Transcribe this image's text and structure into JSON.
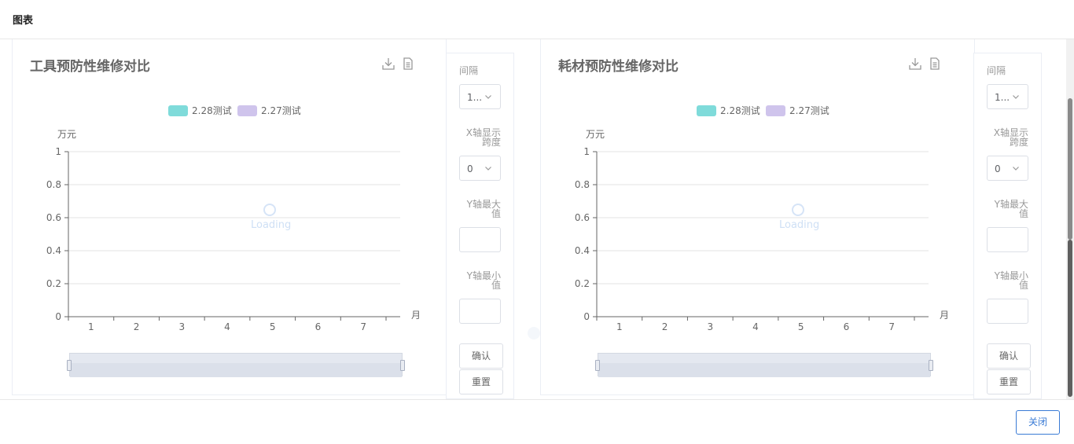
{
  "dialog": {
    "title": "图表",
    "close_label": "关闭"
  },
  "panels": [
    {
      "title": "工具预防性维修对比",
      "icons": [
        "download-icon",
        "data-view-icon"
      ],
      "loading_text": "Loading",
      "sidebar": {
        "interval_label": "间隔",
        "interval_value": "1...",
        "x_span_label_line1": "X轴显示",
        "x_span_label_line2": "跨度",
        "x_span_value": "0",
        "y_max_label_line1": "Y轴最大",
        "y_max_label_line2": "值",
        "y_max_value": "",
        "y_min_label_line1": "Y轴最小",
        "y_min_label_line2": "值",
        "y_min_value": "",
        "confirm_label": "确认",
        "reset_label": "重置"
      },
      "chart_data": {
        "type": "bar",
        "legend": [
          {
            "name": "2.28测试",
            "color": "#7fdbda"
          },
          {
            "name": "2.27测试",
            "color": "#cfc4ec"
          }
        ],
        "legend_position": "top-center",
        "categories": [
          "1",
          "2",
          "3",
          "4",
          "5",
          "6",
          "7"
        ],
        "series": [
          {
            "name": "2.28测试",
            "values": []
          },
          {
            "name": "2.27测试",
            "values": []
          }
        ],
        "ylabel": "万元",
        "xlabel": "月",
        "ylim": [
          0,
          1
        ],
        "yticks": [
          "0",
          "0.2",
          "0.4",
          "0.6",
          "0.8",
          "1"
        ],
        "grid": true
      }
    },
    {
      "title": "耗材预防性维修对比",
      "icons": [
        "download-icon",
        "data-view-icon"
      ],
      "loading_text": "Loading",
      "sidebar": {
        "interval_label": "间隔",
        "interval_value": "1...",
        "x_span_label_line1": "X轴显示",
        "x_span_label_line2": "跨度",
        "x_span_value": "0",
        "y_max_label_line1": "Y轴最大",
        "y_max_label_line2": "值",
        "y_max_value": "",
        "y_min_label_line1": "Y轴最小",
        "y_min_label_line2": "值",
        "y_min_value": "",
        "confirm_label": "确认",
        "reset_label": "重置"
      },
      "chart_data": {
        "type": "bar",
        "legend": [
          {
            "name": "2.28测试",
            "color": "#7fdbda"
          },
          {
            "name": "2.27测试",
            "color": "#cfc4ec"
          }
        ],
        "legend_position": "top-center",
        "categories": [
          "1",
          "2",
          "3",
          "4",
          "5",
          "6",
          "7"
        ],
        "series": [
          {
            "name": "2.28测试",
            "values": []
          },
          {
            "name": "2.27测试",
            "values": []
          }
        ],
        "ylabel": "万元",
        "xlabel": "月",
        "ylim": [
          0,
          1
        ],
        "yticks": [
          "0",
          "0.2",
          "0.4",
          "0.6",
          "0.8",
          "1"
        ],
        "grid": true
      }
    }
  ]
}
